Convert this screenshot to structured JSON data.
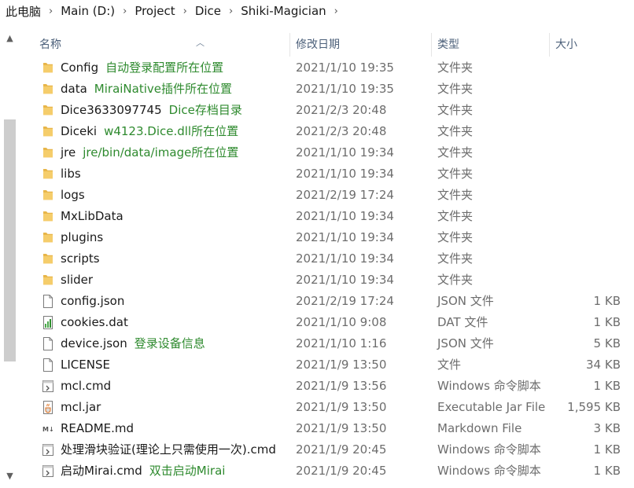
{
  "breadcrumb": [
    "此电脑",
    "Main (D:)",
    "Project",
    "Dice",
    "Shiki-Magician"
  ],
  "columns": {
    "name": "名称",
    "date": "修改日期",
    "type": "类型",
    "size": "大小"
  },
  "files": [
    {
      "name": "Config",
      "annotation": "自动登录配置所在位置",
      "date": "2021/1/10 19:35",
      "type": "文件夹",
      "size": "",
      "icon": "folder-icon"
    },
    {
      "name": "data",
      "annotation": "MiraiNative插件所在位置",
      "date": "2021/1/10 19:35",
      "type": "文件夹",
      "size": "",
      "icon": "folder-icon"
    },
    {
      "name": "Dice3633097745",
      "annotation": "Dice存档目录",
      "date": "2021/2/3 20:48",
      "type": "文件夹",
      "size": "",
      "icon": "folder-icon"
    },
    {
      "name": "Diceki",
      "annotation": "w4123.Dice.dll所在位置",
      "date": "2021/2/3 20:48",
      "type": "文件夹",
      "size": "",
      "icon": "folder-icon"
    },
    {
      "name": "jre",
      "annotation": "jre/bin/data/image所在位置",
      "date": "2021/1/10 19:34",
      "type": "文件夹",
      "size": "",
      "icon": "folder-icon"
    },
    {
      "name": "libs",
      "annotation": "",
      "date": "2021/1/10 19:34",
      "type": "文件夹",
      "size": "",
      "icon": "folder-icon"
    },
    {
      "name": "logs",
      "annotation": "",
      "date": "2021/2/19 17:24",
      "type": "文件夹",
      "size": "",
      "icon": "folder-icon"
    },
    {
      "name": "MxLibData",
      "annotation": "",
      "date": "2021/1/10 19:34",
      "type": "文件夹",
      "size": "",
      "icon": "folder-icon"
    },
    {
      "name": "plugins",
      "annotation": "",
      "date": "2021/1/10 19:34",
      "type": "文件夹",
      "size": "",
      "icon": "folder-icon"
    },
    {
      "name": "scripts",
      "annotation": "",
      "date": "2021/1/10 19:34",
      "type": "文件夹",
      "size": "",
      "icon": "folder-icon"
    },
    {
      "name": "slider",
      "annotation": "",
      "date": "2021/1/10 19:34",
      "type": "文件夹",
      "size": "",
      "icon": "folder-icon"
    },
    {
      "name": "config.json",
      "annotation": "",
      "date": "2021/2/19 17:24",
      "type": "JSON 文件",
      "size": "1 KB",
      "icon": "json-file-icon"
    },
    {
      "name": "cookies.dat",
      "annotation": "",
      "date": "2021/1/10 9:08",
      "type": "DAT 文件",
      "size": "1 KB",
      "icon": "dat-file-icon"
    },
    {
      "name": "device.json",
      "annotation": "登录设备信息",
      "date": "2021/1/10 1:16",
      "type": "JSON 文件",
      "size": "5 KB",
      "icon": "json-file-icon"
    },
    {
      "name": "LICENSE",
      "annotation": "",
      "date": "2021/1/9 13:50",
      "type": "文件",
      "size": "34 KB",
      "icon": "blank-file-icon"
    },
    {
      "name": "mcl.cmd",
      "annotation": "",
      "date": "2021/1/9 13:56",
      "type": "Windows 命令脚本",
      "size": "1 KB",
      "icon": "cmd-file-icon"
    },
    {
      "name": "mcl.jar",
      "annotation": "",
      "date": "2021/1/9 13:50",
      "type": "Executable Jar File",
      "size": "1,595 KB",
      "icon": "jar-file-icon"
    },
    {
      "name": "README.md",
      "annotation": "",
      "date": "2021/1/9 13:50",
      "type": "Markdown File",
      "size": "3 KB",
      "icon": "markdown-file-icon"
    },
    {
      "name": "处理滑块验证(理论上只需使用一次).cmd",
      "annotation": "",
      "date": "2021/1/9 20:45",
      "type": "Windows 命令脚本",
      "size": "1 KB",
      "icon": "cmd-file-icon"
    },
    {
      "name": "启动Mirai.cmd",
      "annotation": "双击启动Mirai",
      "date": "2021/1/9 20:45",
      "type": "Windows 命令脚本",
      "size": "1 KB",
      "icon": "cmd-file-icon"
    }
  ],
  "colors": {
    "annotation": "#2e8a2e",
    "folder": "#e8b64a",
    "header_text": "#4c607a",
    "meta_text": "#6d6d6d"
  }
}
